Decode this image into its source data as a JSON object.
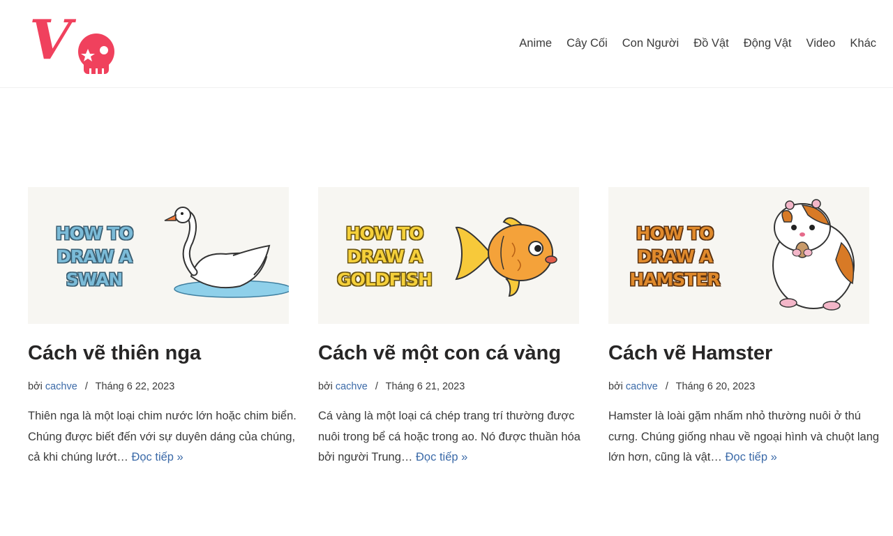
{
  "site": {
    "logo_letter": "V",
    "brand_color": "#f0415d"
  },
  "nav": {
    "items": [
      "Anime",
      "Cây Cối",
      "Con Người",
      "Đồ Vật",
      "Động Vật",
      "Video",
      "Khác"
    ]
  },
  "posts": [
    {
      "thumb_lines": [
        "HOW TO",
        "DRAW A",
        "SWAN"
      ],
      "thumb_color": "#7bbbd8",
      "thumb_outline": "#3b5f73",
      "thumb_subject": "swan-illustration",
      "title": "Cách vẽ thiên nga",
      "meta_prefix": "bởi",
      "author": "cachve",
      "separator": "/",
      "date": "Tháng 6 22, 2023",
      "excerpt": "Thiên nga là một loại chim nước lớn hoặc chim biển. Chúng được biết đến với sự duyên dáng của chúng, cả khi chúng lướt…",
      "read_more": "Đọc tiếp »"
    },
    {
      "thumb_lines": [
        "HOW TO",
        "DRAW A",
        "GOLDFISH"
      ],
      "thumb_color": "#f5d03a",
      "thumb_outline": "#6a5410",
      "thumb_subject": "goldfish-illustration",
      "title": "Cách vẽ một con cá vàng",
      "meta_prefix": "bởi",
      "author": "cachve",
      "separator": "/",
      "date": "Tháng 6 21, 2023",
      "excerpt": "Cá vàng là một loại cá chép trang trí thường được nuôi trong bể cá hoặc trong ao. Nó được thuần hóa bởi người Trung…",
      "read_more": "Đọc tiếp »"
    },
    {
      "thumb_lines": [
        "HOW TO",
        "DRAW A",
        "HAMSTER"
      ],
      "thumb_color": "#e08a2c",
      "thumb_outline": "#5a3110",
      "thumb_subject": "hamster-illustration",
      "title": "Cách vẽ Hamster",
      "meta_prefix": "bởi",
      "author": "cachve",
      "separator": "/",
      "date": "Tháng 6 20, 2023",
      "excerpt": "Hamster là loài gặm nhấm nhỏ thường nuôi ở thú cưng. Chúng giống nhau về ngoại hình và chuột lang lớn hơn, cũng là vật…",
      "read_more": "Đọc tiếp »"
    }
  ]
}
